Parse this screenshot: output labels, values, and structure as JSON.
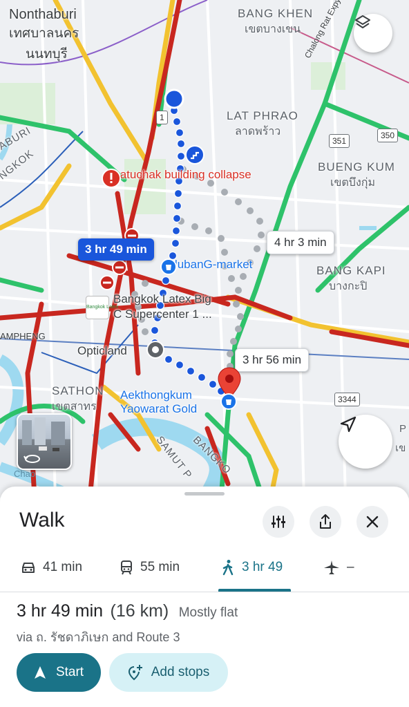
{
  "map": {
    "districts": [
      {
        "en": "Nonthaburi",
        "th": "เทศบาลนคร",
        "th2": "นนทบุรี"
      },
      {
        "en": "BANG KHEN",
        "th": "เขตบางเขน"
      },
      {
        "en": "LAT PHRAO",
        "th": "ลาดพร้าว"
      },
      {
        "en": "BUENG KUM",
        "th": "เขตบึงกุ่ม"
      },
      {
        "en": "BANG KAPI",
        "th": "บางกะปิ"
      },
      {
        "en": "SATHON",
        "th": "เขตสาทร"
      }
    ],
    "edge_labels": {
      "aburi": "ABURI",
      "ngkok": "NGKOK",
      "ampheng": "AMPHENG",
      "chalong": "Chalong Rat Expy",
      "samut": "SAMUT P",
      "bangko": "BANGKO",
      "chao": "Chao",
      "p": "P",
      "khe": "เข"
    },
    "pois": {
      "incident": "Chatuchak building collapse",
      "jiduban": "JidubanG-market",
      "latex_line1": "Bangkok Latex Big",
      "latex_line2": "C Supercenter 1 ...",
      "latex_logo_text": "Bangkok Latex",
      "opticland": "Opticland",
      "aekthong_line1": "Aekthongkum",
      "aekthong_line2": "Yaowarat Gold"
    },
    "route_labels": {
      "primary": "3 hr 49 min",
      "alt1": "4 hr 3 min",
      "alt2": "3 hr 56 min"
    },
    "road_shields": [
      "1",
      "351",
      "350",
      "3344"
    ],
    "colors": {
      "primary_route": "#1a56db",
      "alt_route": "#a8adb3",
      "traffic_green": "#2ec26a",
      "traffic_yellow": "#f2c230",
      "traffic_red": "#c8271f",
      "water": "#9ed9f0",
      "destination_pin": "#ea4335"
    }
  },
  "sheet": {
    "title": "Walk",
    "modes": [
      {
        "icon": "car-icon",
        "label": "41 min"
      },
      {
        "icon": "transit-icon",
        "label": "55 min"
      },
      {
        "icon": "walk-icon",
        "label": "3 hr 49",
        "active": true
      },
      {
        "icon": "flight-icon",
        "label": "–"
      }
    ],
    "summary": {
      "time": "3 hr 49 min",
      "distance": "(16 km)",
      "terrain": "Mostly flat"
    },
    "via": "via ถ. รัชดาภิเษก and Route 3",
    "buttons": {
      "start": "Start",
      "add_stops": "Add stops"
    },
    "accent_color": "#1a7388"
  }
}
